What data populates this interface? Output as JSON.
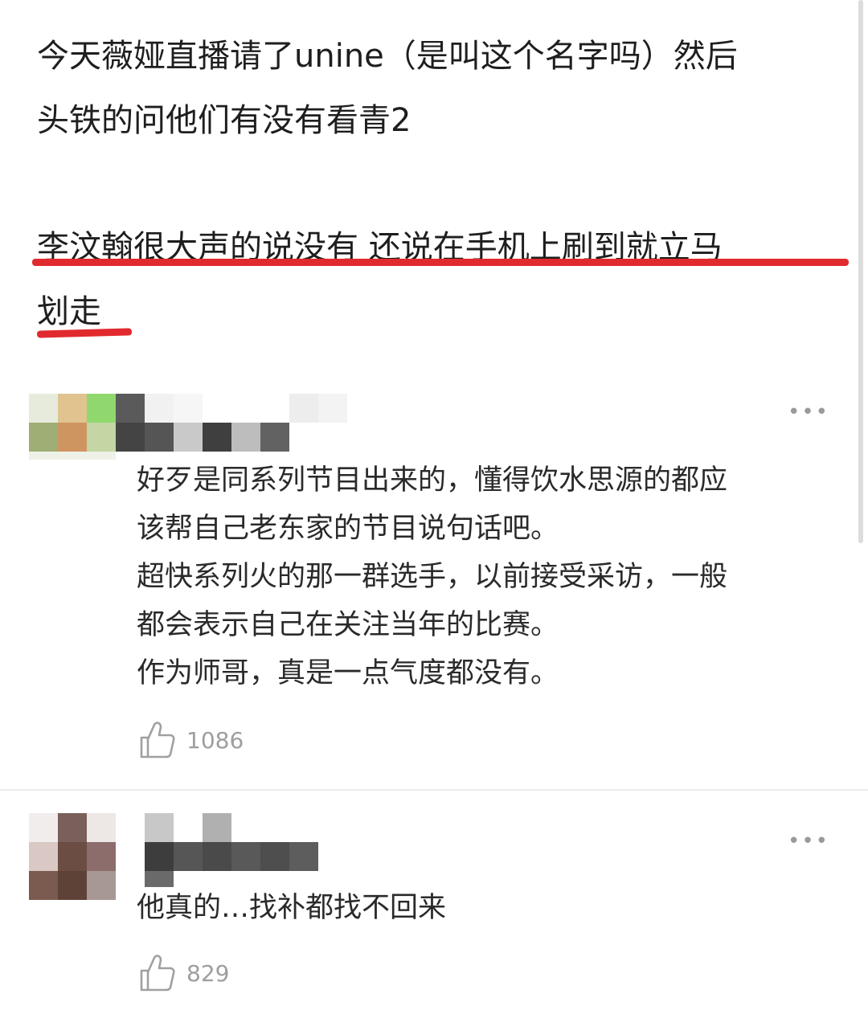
{
  "post": {
    "line1": "今天薇娅直播请了unine（是叫这个名字吗）然后",
    "line2": "头铁的问他们有没有看青2",
    "line3": "李汶翰很大声的说没有 还说在手机上刷到就立马",
    "line4": "划走"
  },
  "comments": [
    {
      "more_icon": "•••",
      "lines": [
        "好歹是同系列节目出来的，懂得饮水思源的都应",
        "该帮自己老东家的节目说句话吧。",
        "超快系列火的那一群选手，以前接受采访，一般",
        "都会表示自己在关注当年的比赛。",
        "作为师哥，真是一点气度都没有。"
      ],
      "likes": "1086"
    },
    {
      "more_icon": "•••",
      "lines": [
        "他真的…找补都找不回来"
      ],
      "likes": "829"
    }
  ],
  "colors": {
    "underline": "#e12a2e",
    "like_icon": "#9e9e9e"
  }
}
